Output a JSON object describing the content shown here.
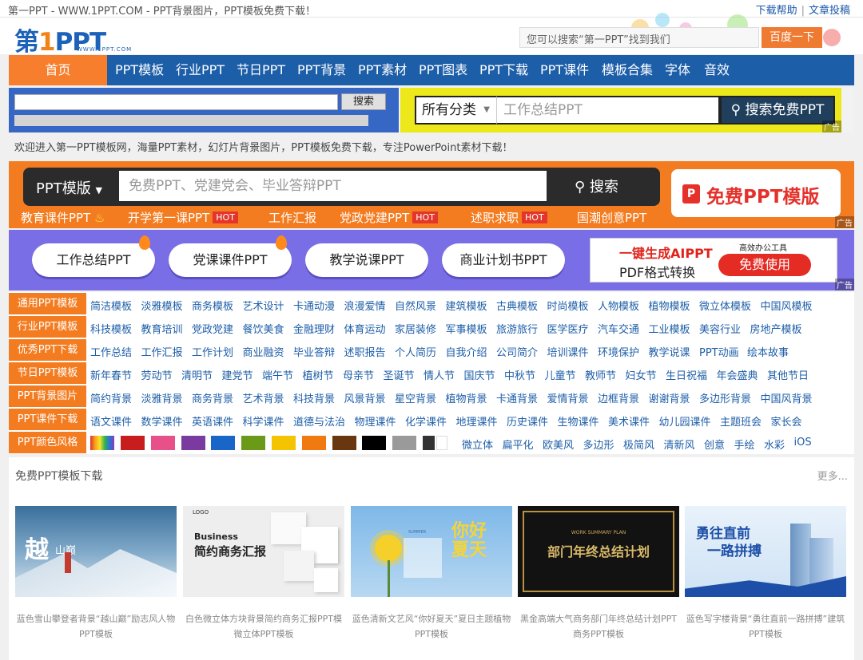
{
  "topbar": {
    "site_title": "第一PPT - WWW.1PPT.COM - PPT背景图片，PPT模板免费下载！",
    "link_help": "下载帮助",
    "link_submit": "文章投稿"
  },
  "header": {
    "logo_text_a": "第",
    "logo_text_b": "1",
    "logo_text_c": "PPT",
    "logo_domain": "WWW.1PPT.COM",
    "search_placeholder": "您可以搜索“第一PPT”找到我们",
    "search_button": "百度一下"
  },
  "nav": [
    "首页",
    "PPT模板",
    "行业PPT",
    "节日PPT",
    "PPT背景",
    "PPT素材",
    "PPT图表",
    "PPT下载",
    "PPT课件",
    "模板合集",
    "字体",
    "音效"
  ],
  "bar2": {
    "search_button": "搜索",
    "category_select": "所有分类",
    "keyword_placeholder": "工作总结PPT",
    "search_free_button": "搜索免费PPT",
    "ad_tag": "广告"
  },
  "welcome": "欢迎进入第一PPT模板网，海量PPT素材，幻灯片背景图片，PPT模板免费下载，专注PowerPoint素材下载！",
  "banner1": {
    "dropdown": "PPT模版",
    "placeholder": "免费PPT、党建党会、毕业答辩PPT",
    "search_label": "搜索",
    "cta_label": "免费PPT模版",
    "p_icon_letter": "P",
    "ad_tag": "广告",
    "links": [
      {
        "label": "教育课件PPT",
        "hot": ""
      },
      {
        "label": "开学第一课PPT",
        "hot": "HOT"
      },
      {
        "label": "工作汇报",
        "hot": ""
      },
      {
        "label": "党政党建PPT",
        "hot": "HOT"
      },
      {
        "label": "述职求职",
        "hot": "HOT"
      },
      {
        "label": "国潮创意PPT",
        "hot": ""
      }
    ]
  },
  "banner2": {
    "pills": [
      "工作总结PPT",
      "党课课件PPT",
      "教学说课PPT",
      "商业计划书PPT"
    ],
    "ai_title": "一键生成AIPPT",
    "ai_sub": "PDF格式转换",
    "ai_tag": "高效办公工具",
    "ai_button": "免费使用",
    "ad_tag": "广告"
  },
  "categories": [
    {
      "label": "通用PPT模板",
      "links": [
        "简洁模板",
        "淡雅模板",
        "商务模板",
        "艺术设计",
        "卡通动漫",
        "浪漫爱情",
        "自然风景",
        "建筑模板",
        "古典模板",
        "时尚模板",
        "人物模板",
        "植物模板",
        "微立体模板",
        "中国风模板"
      ]
    },
    {
      "label": "行业PPT模板",
      "links": [
        "科技模板",
        "教育培训",
        "党政党建",
        "餐饮美食",
        "金融理财",
        "体育运动",
        "家居装修",
        "军事模板",
        "旅游旅行",
        "医学医疗",
        "汽车交通",
        "工业模板",
        "美容行业",
        "房地产模板"
      ]
    },
    {
      "label": "优秀PPT下载",
      "links": [
        "工作总结",
        "工作汇报",
        "工作计划",
        "商业融资",
        "毕业答辩",
        "述职报告",
        "个人简历",
        "自我介绍",
        "公司简介",
        "培训课件",
        "环境保护",
        "教学说课",
        "PPT动画",
        "绘本故事"
      ]
    },
    {
      "label": "节日PPT模板",
      "links": [
        "新年春节",
        "劳动节",
        "清明节",
        "建党节",
        "端午节",
        "植树节",
        "母亲节",
        "圣诞节",
        "情人节",
        "国庆节",
        "中秋节",
        "儿童节",
        "教师节",
        "妇女节",
        "生日祝福",
        "年会盛典",
        "其他节日"
      ]
    },
    {
      "label": "PPT背景图片",
      "links": [
        "简约背景",
        "淡雅背景",
        "商务背景",
        "艺术背景",
        "科技背景",
        "风景背景",
        "星空背景",
        "植物背景",
        "卡通背景",
        "爱情背景",
        "边框背景",
        "谢谢背景",
        "多边形背景",
        "中国风背景"
      ]
    },
    {
      "label": "PPT课件下载",
      "links": [
        "语文课件",
        "数学课件",
        "英语课件",
        "科学课件",
        "道德与法治",
        "物理课件",
        "化学课件",
        "地理课件",
        "历史课件",
        "生物课件",
        "美术课件",
        "幼儿园课件",
        "主题班会",
        "家长会"
      ]
    },
    {
      "label": "PPT颜色风格",
      "links": [
        "微立体",
        "扁平化",
        "欧美风",
        "多边形",
        "极简风",
        "清新风",
        "创意",
        "手绘",
        "水彩",
        "iOS"
      ]
    }
  ],
  "swatch_colors": [
    "#c81d1d",
    "#e8508a",
    "#7a3aa0",
    "#1a66c8",
    "#6a9a17",
    "#f5c400",
    "#f07a10",
    "#6a360f",
    "#000000",
    "#9a9a9a",
    "#333333"
  ],
  "section": {
    "title": "免费PPT模板下载",
    "more": "更多...",
    "cards": [
      {
        "thumb_title": "越",
        "thumb_sub": "山巅",
        "caption": "蓝色雪山攀登者背景“越山巅”励志风人物PPT模板"
      },
      {
        "thumb_title": "Business",
        "thumb_sub": "简约商务汇报",
        "thumb_tag": "LOGO",
        "caption": "白色微立体方块背景简约商务汇报PPT模微立体PPT模板"
      },
      {
        "thumb_title": "你好夏天",
        "thumb_sub": "SUMMER",
        "caption": "蓝色清新文艺风“你好夏天”夏日主题植物PPT模板"
      },
      {
        "thumb_title": "部门年终总结计划",
        "thumb_sub": "WORK SUMMARY PLAN",
        "caption": "黑金高端大气商务部门年终总结计划PPT商务PPT模板"
      },
      {
        "thumb_title": "勇往直前",
        "thumb_sub": "一路拼搏",
        "caption": "蓝色写字楼背景“勇往直前一路拼搏”建筑PPT模板"
      }
    ]
  }
}
